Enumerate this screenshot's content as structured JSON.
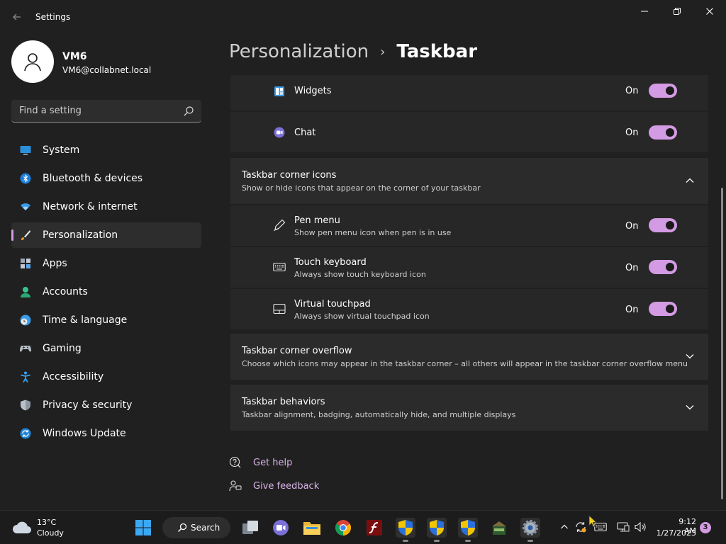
{
  "window": {
    "title": "Settings",
    "controls": {
      "minimize": "minimize-icon",
      "maximize": "restore-icon",
      "close": "close-icon"
    }
  },
  "user": {
    "name": "VM6",
    "email": "VM6@collabnet.local"
  },
  "search": {
    "placeholder": "Find a setting"
  },
  "sidebar": {
    "items": [
      {
        "label": "System",
        "icon": "monitor-icon",
        "active": false
      },
      {
        "label": "Bluetooth & devices",
        "icon": "bluetooth-icon",
        "active": false
      },
      {
        "label": "Network & internet",
        "icon": "wifi-icon",
        "active": false
      },
      {
        "label": "Personalization",
        "icon": "brush-icon",
        "active": true
      },
      {
        "label": "Apps",
        "icon": "apps-icon",
        "active": false
      },
      {
        "label": "Accounts",
        "icon": "person-icon",
        "active": false
      },
      {
        "label": "Time & language",
        "icon": "clock-globe-icon",
        "active": false
      },
      {
        "label": "Gaming",
        "icon": "gamepad-icon",
        "active": false
      },
      {
        "label": "Accessibility",
        "icon": "accessibility-icon",
        "active": false
      },
      {
        "label": "Privacy & security",
        "icon": "shield-icon",
        "active": false
      },
      {
        "label": "Windows Update",
        "icon": "update-icon",
        "active": false
      }
    ]
  },
  "breadcrumb": {
    "parent": "Personalization",
    "separator": "›",
    "current": "Taskbar"
  },
  "taskbar_items": {
    "widgets": {
      "label": "Widgets",
      "state": "On",
      "enabled": true
    },
    "chat": {
      "label": "Chat",
      "state": "On",
      "enabled": true
    }
  },
  "corner_icons": {
    "title": "Taskbar corner icons",
    "description": "Show or hide icons that appear on the corner of your taskbar",
    "items": [
      {
        "title": "Pen menu",
        "description": "Show pen menu icon when pen is in use",
        "state": "On",
        "enabled": true,
        "icon": "pen-icon"
      },
      {
        "title": "Touch keyboard",
        "description": "Always show touch keyboard icon",
        "state": "On",
        "enabled": true,
        "icon": "keyboard-icon"
      },
      {
        "title": "Virtual touchpad",
        "description": "Always show virtual touchpad icon",
        "state": "On",
        "enabled": true,
        "icon": "touchpad-icon"
      }
    ]
  },
  "corner_overflow": {
    "title": "Taskbar corner overflow",
    "description": "Choose which icons may appear in the taskbar corner – all others will appear in the taskbar corner overflow menu"
  },
  "behaviors": {
    "title": "Taskbar behaviors",
    "description": "Taskbar alignment, badging, automatically hide, and multiple displays"
  },
  "help": {
    "get_help": "Get help",
    "give_feedback": "Give feedback"
  },
  "taskbar": {
    "weather": {
      "temp": "13°C",
      "condition": "Cloudy"
    },
    "search_label": "Search",
    "clock": {
      "time": "9:12 AM",
      "date": "1/27/2023"
    },
    "notifications": "3"
  },
  "colors": {
    "accent": "#d39be3",
    "background": "#202020",
    "card": "#2b2b2b",
    "link": "#d8b4e8"
  }
}
